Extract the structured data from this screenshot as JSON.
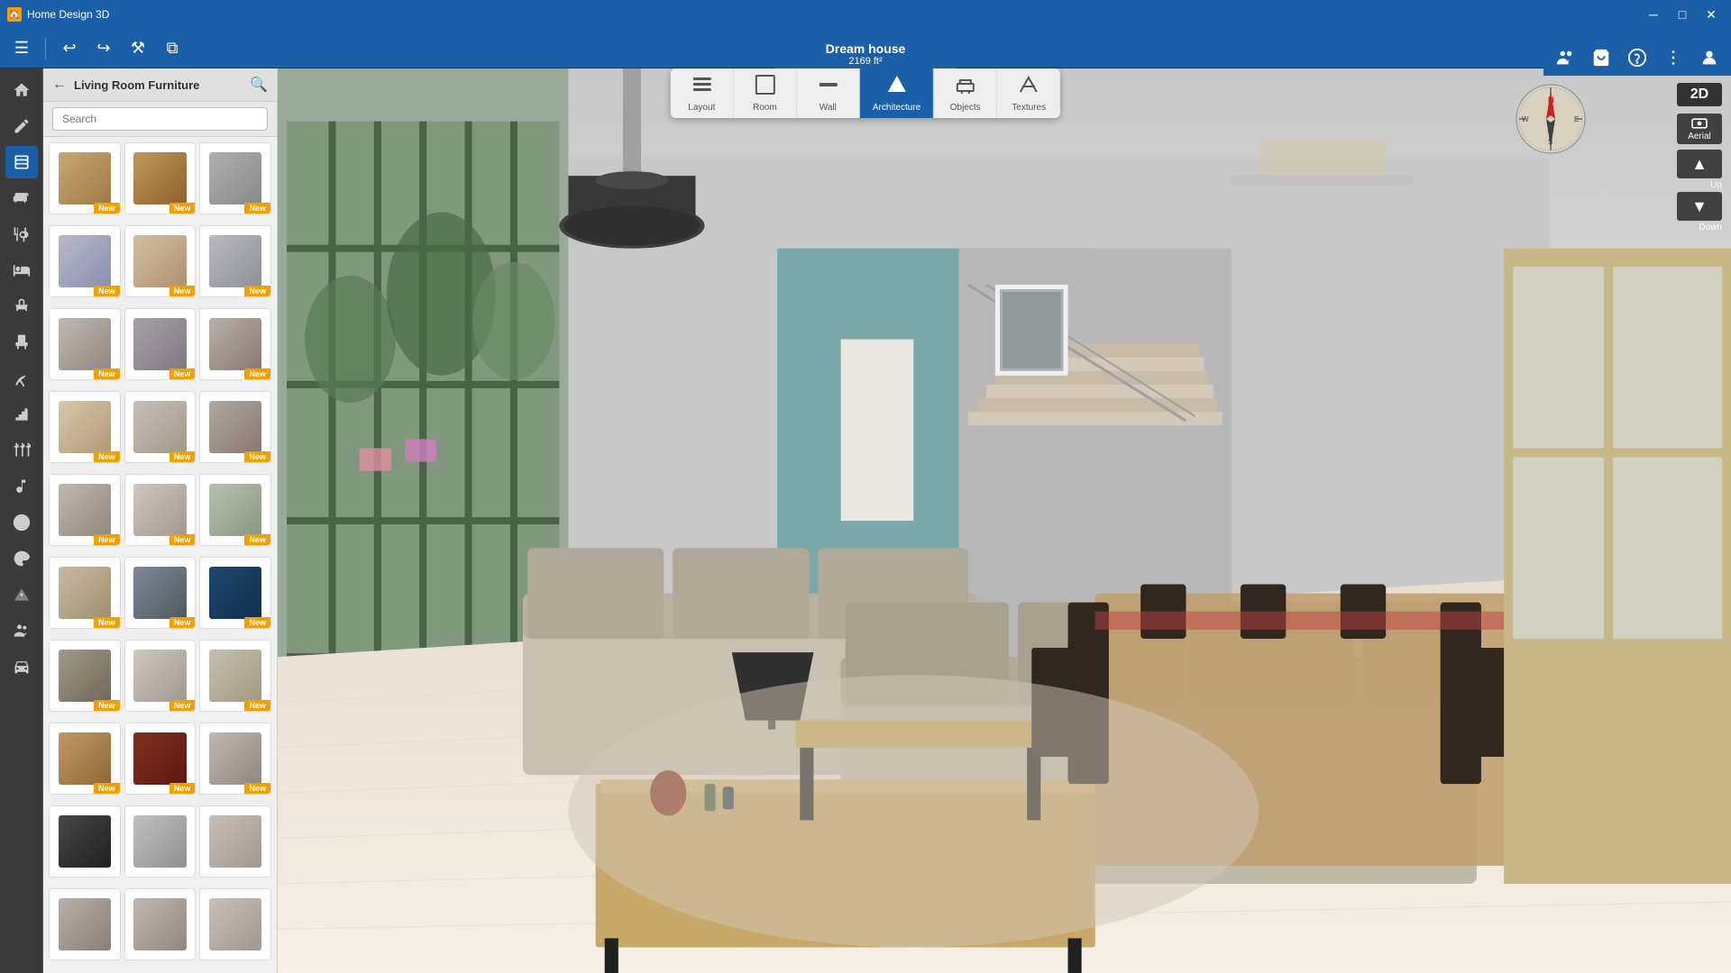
{
  "titlebar": {
    "app_name": "Home Design 3D",
    "minimize_label": "─",
    "maximize_label": "□",
    "close_label": "✕"
  },
  "toolbar": {
    "menu_label": "☰",
    "undo_label": "↩",
    "redo_label": "↪",
    "build_label": "⚒",
    "copy_label": "⧉"
  },
  "project": {
    "name": "Dream house",
    "size": "2169 ft²"
  },
  "center_toolbar": {
    "tools": [
      {
        "id": "layout",
        "label": "Layout",
        "icon": "▭"
      },
      {
        "id": "room",
        "label": "Room",
        "icon": "⬜"
      },
      {
        "id": "wall",
        "label": "Wall",
        "icon": "▬"
      },
      {
        "id": "architecture",
        "label": "Architecture",
        "icon": "🏠"
      },
      {
        "id": "objects",
        "label": "Objects",
        "icon": "🪑"
      },
      {
        "id": "textures",
        "label": "Textures",
        "icon": "🖌"
      }
    ],
    "active": "objects"
  },
  "top_right": {
    "people_label": "👥",
    "cart_label": "🛒",
    "help_label": "?",
    "menu_label": "⋮",
    "user_label": "👤"
  },
  "left_sidebar": {
    "icons": [
      {
        "id": "home",
        "icon": "⌂"
      },
      {
        "id": "tools",
        "icon": "✏"
      },
      {
        "id": "layers",
        "icon": "▤"
      },
      {
        "id": "furniture",
        "icon": "🪑"
      },
      {
        "id": "kitchen",
        "icon": "🍴"
      },
      {
        "id": "bed",
        "icon": "🛏"
      },
      {
        "id": "horse",
        "icon": "🐴"
      },
      {
        "id": "office",
        "icon": "🖥"
      },
      {
        "id": "outdoor",
        "icon": "🌳"
      },
      {
        "id": "stairs",
        "icon": "⚡"
      },
      {
        "id": "fence",
        "icon": "⬜"
      },
      {
        "id": "music",
        "icon": "♪"
      },
      {
        "id": "sport",
        "icon": "⚽"
      },
      {
        "id": "art",
        "icon": "🎨"
      },
      {
        "id": "misc",
        "icon": "✱"
      },
      {
        "id": "people",
        "icon": "👥"
      },
      {
        "id": "cars",
        "icon": "🚗"
      }
    ]
  },
  "panel": {
    "title": "Living Room Furniture",
    "search_placeholder": "Search",
    "back_label": "←",
    "search_icon": "🔍",
    "new_badge": "New"
  },
  "furniture_items": [
    {
      "id": 1,
      "color_start": "#c8a870",
      "color_end": "#a07848",
      "has_new": true
    },
    {
      "id": 2,
      "color_start": "#c8a060",
      "color_end": "#906030",
      "has_new": true
    },
    {
      "id": 3,
      "color_start": "#a8a0a0",
      "color_end": "#787878",
      "has_new": true
    },
    {
      "id": 4,
      "color_start": "#b8b8c8",
      "color_end": "#8890b0",
      "has_new": true
    },
    {
      "id": 5,
      "color_start": "#d0c0a0",
      "color_end": "#b09070",
      "has_new": true
    },
    {
      "id": 6,
      "color_start": "#b8b8c0",
      "color_end": "#909098",
      "has_new": true
    },
    {
      "id": 7,
      "color_start": "#c0b8b0",
      "color_end": "#908880",
      "has_new": true
    },
    {
      "id": 8,
      "color_start": "#a8a0a8",
      "color_end": "#807880",
      "has_new": true
    },
    {
      "id": 9,
      "color_start": "#b8b0a8",
      "color_end": "#887870",
      "has_new": true
    },
    {
      "id": 10,
      "color_start": "#d8c8a8",
      "color_end": "#b09878",
      "has_new": true
    },
    {
      "id": 11,
      "color_start": "#c8c0b8",
      "color_end": "#a09888",
      "has_new": true
    },
    {
      "id": 12,
      "color_start": "#b0a8a0",
      "color_end": "#887870",
      "has_new": true
    },
    {
      "id": 13,
      "color_start": "#c0b8b0",
      "color_end": "#908880",
      "has_new": true
    },
    {
      "id": 14,
      "color_start": "#d0c8c0",
      "color_end": "#a09890",
      "has_new": true
    },
    {
      "id": 15,
      "color_start": "#b8c0b0",
      "color_end": "#889880",
      "has_new": true
    },
    {
      "id": 16,
      "color_start": "#c8b8a0",
      "color_end": "#a09070",
      "has_new": true
    },
    {
      "id": 17,
      "color_start": "#808898",
      "color_end": "#505860",
      "has_new": true
    },
    {
      "id": 18,
      "color_start": "#204870",
      "color_end": "#103050",
      "has_new": true
    },
    {
      "id": 19,
      "color_start": "#a09888",
      "color_end": "#706858",
      "has_new": true
    },
    {
      "id": 20,
      "color_start": "#d0c8c0",
      "color_end": "#a09890",
      "has_new": true
    },
    {
      "id": 21,
      "color_start": "#c8c0b0",
      "color_end": "#a09880",
      "has_new": true
    },
    {
      "id": 22,
      "color_start": "#c09868",
      "color_end": "#906838",
      "has_new": true
    },
    {
      "id": 23,
      "color_start": "#803020",
      "color_end": "#601810",
      "has_new": true
    },
    {
      "id": 24,
      "color_start": "#c0b8b0",
      "color_end": "#908880",
      "has_new": true
    },
    {
      "id": 25,
      "color_start": "#484848",
      "color_end": "#202020",
      "has_new": false
    },
    {
      "id": 26,
      "color_start": "#c0c0c0",
      "color_end": "#909090",
      "has_new": false
    },
    {
      "id": 27,
      "color_start": "#c8c0b8",
      "color_end": "#a09890",
      "has_new": false
    },
    {
      "id": 28,
      "color_start": "#b8b0a8",
      "color_end": "#888078",
      "has_new": false
    },
    {
      "id": 29,
      "color_start": "#c0b8b0",
      "color_end": "#908880",
      "has_new": false
    },
    {
      "id": 30,
      "color_start": "#c8c0b8",
      "color_end": "#a09890",
      "has_new": false
    }
  ],
  "view_controls": {
    "btn_2d": "2D",
    "aerial": "Aerial",
    "up": "Up",
    "down": "Down"
  },
  "compass": {
    "n": "N",
    "s": "S",
    "e": "E",
    "w": "W"
  }
}
